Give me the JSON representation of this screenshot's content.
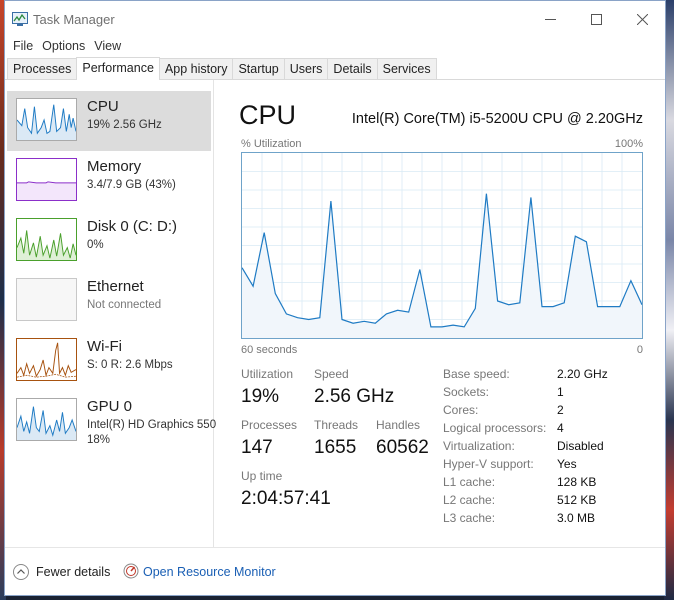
{
  "window": {
    "title": "Task Manager",
    "min_glyph": "—",
    "max_glyph": "☐",
    "close_glyph": "✕"
  },
  "menu": [
    "File",
    "Options",
    "View"
  ],
  "tabs": [
    {
      "label": "Processes"
    },
    {
      "label": "Performance",
      "active": true
    },
    {
      "label": "App history"
    },
    {
      "label": "Startup"
    },
    {
      "label": "Users"
    },
    {
      "label": "Details"
    },
    {
      "label": "Services"
    }
  ],
  "sidebar": {
    "items": [
      {
        "name": "CPU",
        "sub1": "19% 2.56 GHz",
        "sub2": "",
        "color": "#1f7bc4",
        "selected": true
      },
      {
        "name": "Memory",
        "sub1": "3.4/7.9 GB (43%)",
        "sub2": "",
        "color": "#8b2fc9"
      },
      {
        "name": "Disk 0 (C: D:)",
        "sub1": "0%",
        "sub2": "",
        "color": "#4aa02c"
      },
      {
        "name": "Ethernet",
        "sub1": "Not connected",
        "sub2": "",
        "color": "#a0a0a0"
      },
      {
        "name": "Wi-Fi",
        "sub1": "S: 0 R: 2.6 Mbps",
        "sub2": "",
        "color": "#a7520f"
      },
      {
        "name": "GPU 0",
        "sub1": "Intel(R) HD Graphics 550",
        "sub2": "18%",
        "color": "#1f7bc4"
      }
    ]
  },
  "main": {
    "title": "CPU",
    "model": "Intel(R) Core(TM) i5-5200U CPU @ 2.20GHz",
    "graph_label": "% Utilization",
    "graph_max": "100%",
    "graph_span": "60 seconds",
    "graph_min": "0",
    "utilization_series": [
      38,
      28,
      57,
      24,
      13,
      11,
      10,
      11,
      74,
      10,
      8,
      9,
      8,
      13,
      15,
      14,
      37,
      6,
      6,
      7,
      6,
      16,
      78,
      20,
      18,
      19,
      76,
      17,
      17,
      19,
      55,
      52,
      17,
      17,
      17,
      31,
      18
    ],
    "stats": {
      "utilization_label": "Utilization",
      "utilization_value": "19%",
      "speed_label": "Speed",
      "speed_value": "2.56 GHz",
      "processes_label": "Processes",
      "processes_value": "147",
      "threads_label": "Threads",
      "threads_value": "1655",
      "handles_label": "Handles",
      "handles_value": "60562",
      "uptime_label": "Up time",
      "uptime_value": "2:04:57:41"
    },
    "specs": [
      {
        "label": "Base speed:",
        "value": "2.20 GHz"
      },
      {
        "label": "Sockets:",
        "value": "1"
      },
      {
        "label": "Cores:",
        "value": "2"
      },
      {
        "label": "Logical processors:",
        "value": "4"
      },
      {
        "label": "Virtualization:",
        "value": "Disabled"
      },
      {
        "label": "Hyper-V support:",
        "value": "Yes"
      },
      {
        "label": "L1 cache:",
        "value": "128 KB"
      },
      {
        "label": "L2 cache:",
        "value": "512 KB"
      },
      {
        "label": "L3 cache:",
        "value": "3.0 MB"
      }
    ]
  },
  "footer": {
    "fewer_details": "Fewer details",
    "resource_monitor": "Open Resource Monitor"
  }
}
